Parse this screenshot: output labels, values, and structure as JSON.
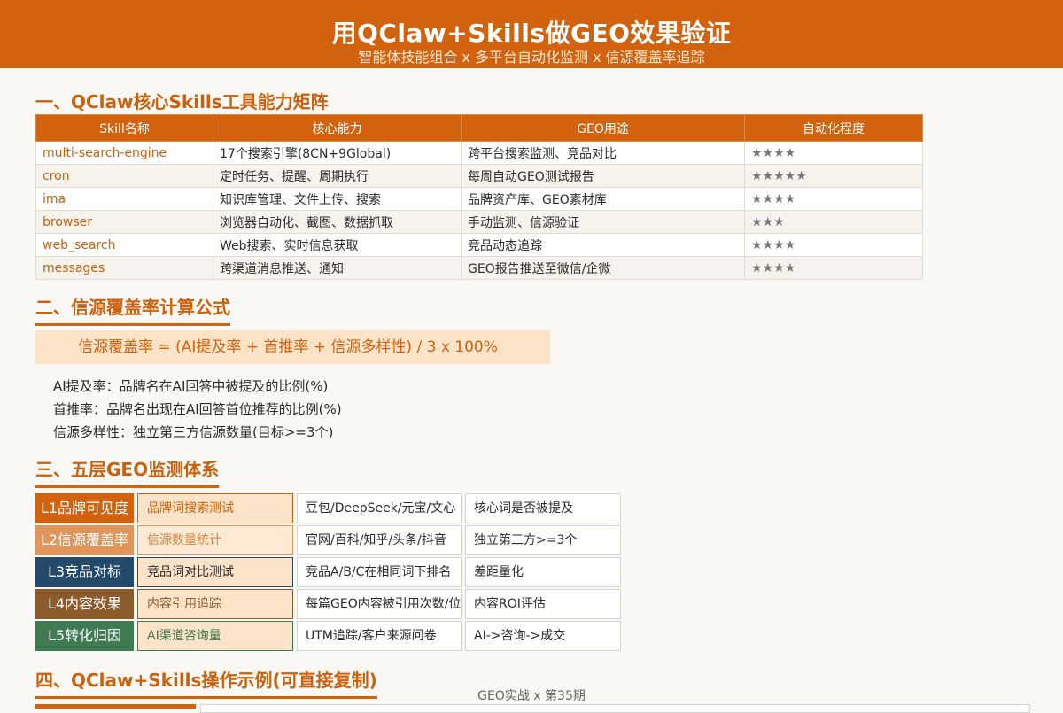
{
  "header": {
    "title": "用QClaw+Skills做GEO效果验证",
    "subtitle": "智能体技能组合 x 多平台自动化监测 x 信源覆盖率追踪"
  },
  "section1": {
    "title": "一、QClaw核心Skills工具能力矩阵",
    "headers": [
      "Skill名称",
      "核心能力",
      "GEO用途",
      "自动化程度"
    ],
    "rows": [
      {
        "skill": "multi-search-engine",
        "capability": "17个搜索引擎(8CN+9Global)",
        "usage": "跨平台搜索监测、竞品对比",
        "stars": "★★★★"
      },
      {
        "skill": "cron",
        "capability": "定时任务、提醒、周期执行",
        "usage": "每周自动GEO测试报告",
        "stars": "★★★★★"
      },
      {
        "skill": "ima",
        "capability": "知识库管理、文件上传、搜索",
        "usage": "品牌资产库、GEO素材库",
        "stars": "★★★★"
      },
      {
        "skill": "browser",
        "capability": "浏览器自动化、截图、数据抓取",
        "usage": "手动监测、信源验证",
        "stars": "★★★"
      },
      {
        "skill": "web_search",
        "capability": "Web搜索、实时信息获取",
        "usage": "竞品动态追踪",
        "stars": "★★★★"
      },
      {
        "skill": "messages",
        "capability": "跨渠道消息推送、通知",
        "usage": "GEO报告推送至微信/企微",
        "stars": "★★★★"
      }
    ]
  },
  "section2": {
    "title": "二、信源覆盖率计算公式",
    "formula": "信源覆盖率 = (AI提及率 + 首推率 + 信源多样性) / 3 x 100%",
    "definitions": [
      "AI提及率：品牌名在AI回答中被提及的比例(%)",
      "首推率：品牌名出现在AI回答首位推荐的比例(%)",
      "信源多样性：独立第三方信源数量(目标>=3个)"
    ]
  },
  "section3": {
    "title": "三、五层GEO监测体系",
    "levels": [
      {
        "label": "L1品牌可见度",
        "method": "品牌词搜索测试",
        "platforms": "豆包/DeepSeek/元宝/文心",
        "metric": "核心词是否被提及",
        "color": "#d2620d",
        "method_bg": "#fde3c8",
        "method_border": "#d2620d",
        "method_color": "#d2620d"
      },
      {
        "label": "L2信源覆盖率",
        "method": "信源数量统计",
        "platforms": "官网/百科/知乎/头条/抖音",
        "metric": "独立第三方>=3个",
        "color": "#e0955a",
        "method_bg": "#fde9d4",
        "method_border": "#e0955a",
        "method_color": "#d2863f"
      },
      {
        "label": "L3竞品对标",
        "method": "竞品词对比测试",
        "platforms": "竞品A/B/C在相同词下排名",
        "metric": "差距量化",
        "color": "#234a6b",
        "method_bg": "#fde3c8",
        "method_border": "#234a6b",
        "method_color": "#2b2b2b"
      },
      {
        "label": "L4内容效果",
        "method": "内容引用追踪",
        "platforms": "每篇GEO内容被引用次数/位",
        "metric": "内容ROI评估",
        "color": "#8c5a2b",
        "method_bg": "#fde3c8",
        "method_border": "#8c5a2b",
        "method_color": "#8c5a2b"
      },
      {
        "label": "L5转化归因",
        "method": "AI渠道咨询量",
        "platforms": "UTM追踪/客户来源问卷",
        "metric": "AI->咨询->成交",
        "color": "#3e7b52",
        "method_bg": "#fde3c8",
        "method_border": "#3e7b52",
        "method_color": "#3e7b52"
      }
    ]
  },
  "section4": {
    "title": "四、QClaw+Skills操作示例(可直接复制)"
  },
  "footer": {
    "text": "GEO实战 x 第35期"
  }
}
